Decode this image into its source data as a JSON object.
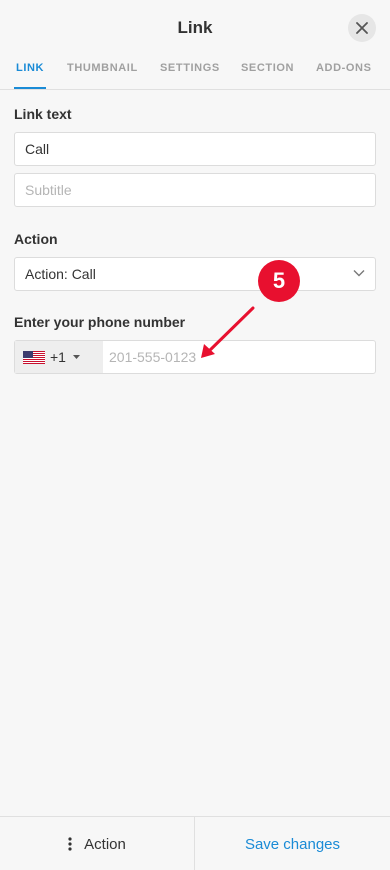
{
  "header": {
    "title": "Link",
    "close_icon": "close-icon"
  },
  "tabs": [
    {
      "label": "LINK",
      "active": true
    },
    {
      "label": "THUMBNAIL",
      "active": false
    },
    {
      "label": "SETTINGS",
      "active": false
    },
    {
      "label": "SECTION",
      "active": false
    },
    {
      "label": "ADD-ONS",
      "active": false
    }
  ],
  "form": {
    "link_text_label": "Link text",
    "link_text_value": "Call",
    "subtitle_placeholder": "Subtitle",
    "action_label": "Action",
    "action_value": "Action: Call",
    "phone_label": "Enter your phone number",
    "country_flag": "us-flag-icon",
    "dial_code": "+1",
    "phone_placeholder": "201-555-0123"
  },
  "annotation": {
    "step_number": "5",
    "color": "#e8102f"
  },
  "footer": {
    "action_label": "Action",
    "save_label": "Save changes"
  },
  "colors": {
    "accent": "#1a8bd6",
    "background": "#f7f7f7"
  }
}
